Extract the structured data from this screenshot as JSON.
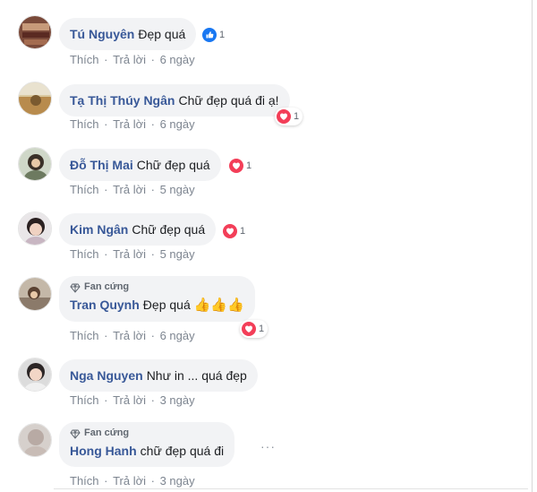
{
  "comments": [
    {
      "name": "Tú Nguyên",
      "text": "Đẹp quá",
      "reaction": {
        "type": "like",
        "count": "1"
      },
      "actions": {
        "like": "Thích",
        "reply": "Trả lời",
        "time": "6 ngày"
      }
    },
    {
      "name": "Tạ Thị Thúy Ngân",
      "text": "Chữ đẹp quá đi ạ!",
      "reaction": {
        "type": "love",
        "count": "1"
      },
      "actions": {
        "like": "Thích",
        "reply": "Trả lời",
        "time": "6 ngày"
      }
    },
    {
      "name": "Đỗ Thị Mai",
      "text": "Chữ đẹp quá",
      "reaction": {
        "type": "love",
        "count": "1"
      },
      "actions": {
        "like": "Thích",
        "reply": "Trả lời",
        "time": "5 ngày"
      }
    },
    {
      "name": "Kim Ngân",
      "text": "Chữ đẹp quá",
      "reaction": {
        "type": "love",
        "count": "1"
      },
      "actions": {
        "like": "Thích",
        "reply": "Trả lời",
        "time": "5 ngày"
      }
    },
    {
      "badge": "Fan cứng",
      "name": "Tran Quynh",
      "text": "Đẹp quá",
      "emoji": "👍👍👍",
      "reaction": {
        "type": "love",
        "count": "1"
      },
      "actions": {
        "like": "Thích",
        "reply": "Trả lời",
        "time": "6 ngày"
      }
    },
    {
      "name": "Nga Nguyen",
      "text": "Như in ... quá đẹp",
      "actions": {
        "like": "Thích",
        "reply": "Trả lời",
        "time": "3 ngày"
      }
    },
    {
      "badge": "Fan cứng",
      "name": "Hong Hanh",
      "text": "chữ đẹp quá đi",
      "more": "···",
      "actions": {
        "like": "Thích",
        "reply": "Trả lời",
        "time": "3 ngày"
      }
    }
  ],
  "colors": {
    "name": "#385898",
    "bubble": "#f2f3f5",
    "like": "#1877f2",
    "love": "#f33e58",
    "meta": "#7d8590"
  },
  "icons": {
    "badge": "diamond-icon",
    "like": "like-icon",
    "love": "love-icon",
    "more": "more-dots-icon"
  }
}
